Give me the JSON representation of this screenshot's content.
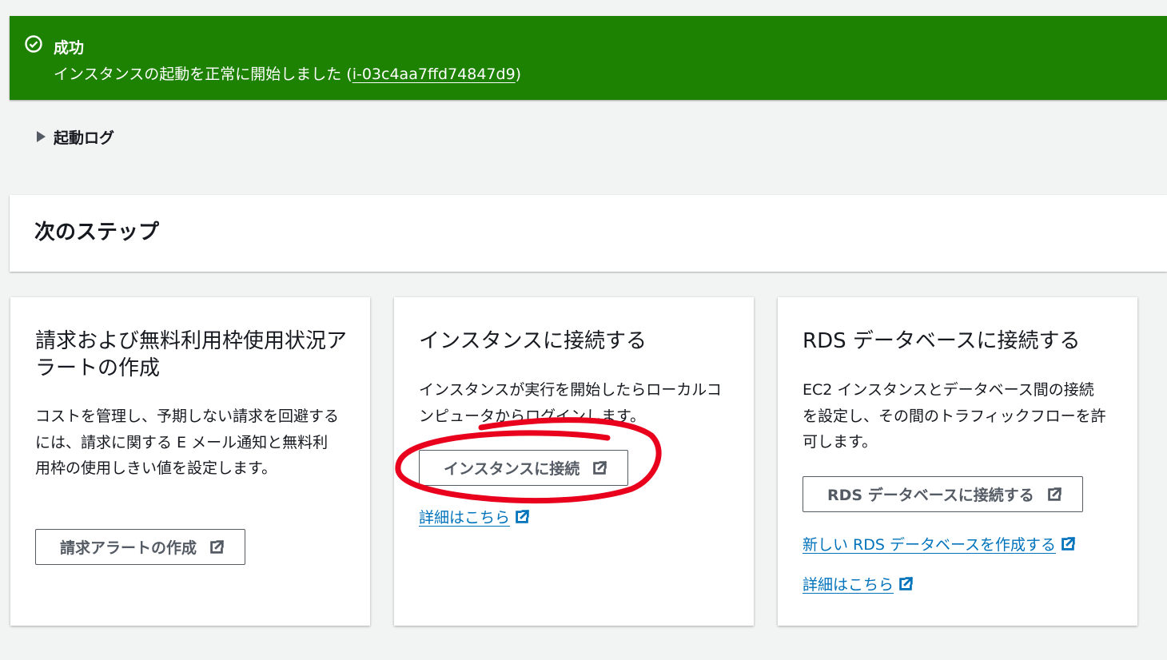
{
  "flash": {
    "icon": "check-circle-icon",
    "title": "成功",
    "message_prefix": "インスタンスの起動を正常に開始しました (",
    "instance_id": "i-03c4aa7ffd74847d9",
    "message_suffix": ")",
    "background": "#1d8102"
  },
  "launch_log": {
    "icon": "caret-right-icon",
    "label": "起動ログ"
  },
  "next_steps": {
    "title": "次のステップ"
  },
  "cards": {
    "billing": {
      "title": "請求および無料利用枠使用状況アラートの作成",
      "body": "コストを管理し、予期しない請求を回避するには、請求に関する E メール通知と無料利用枠の使用しきい値を設定します。",
      "button": "請求アラートの作成"
    },
    "connect": {
      "title": "インスタンスに接続する",
      "body": "インスタンスが実行を開始したらローカルコンピュータからログインします。",
      "button": "インスタンスに接続",
      "link": "詳細はこちら"
    },
    "rds": {
      "title": "RDS データベースに接続する",
      "body": "EC2 インスタンスとデータベース間の接続を設定し、その間のトラフィックフローを許可します。",
      "button": "RDS データベースに接続する",
      "link_create": "新しい RDS データベースを作成する",
      "link_details": "詳細はこちら"
    }
  },
  "icons": {
    "external": "external-link-icon"
  },
  "colors": {
    "link": "#0073bb",
    "button_text": "#545b64",
    "annotation": "#e8001c"
  }
}
